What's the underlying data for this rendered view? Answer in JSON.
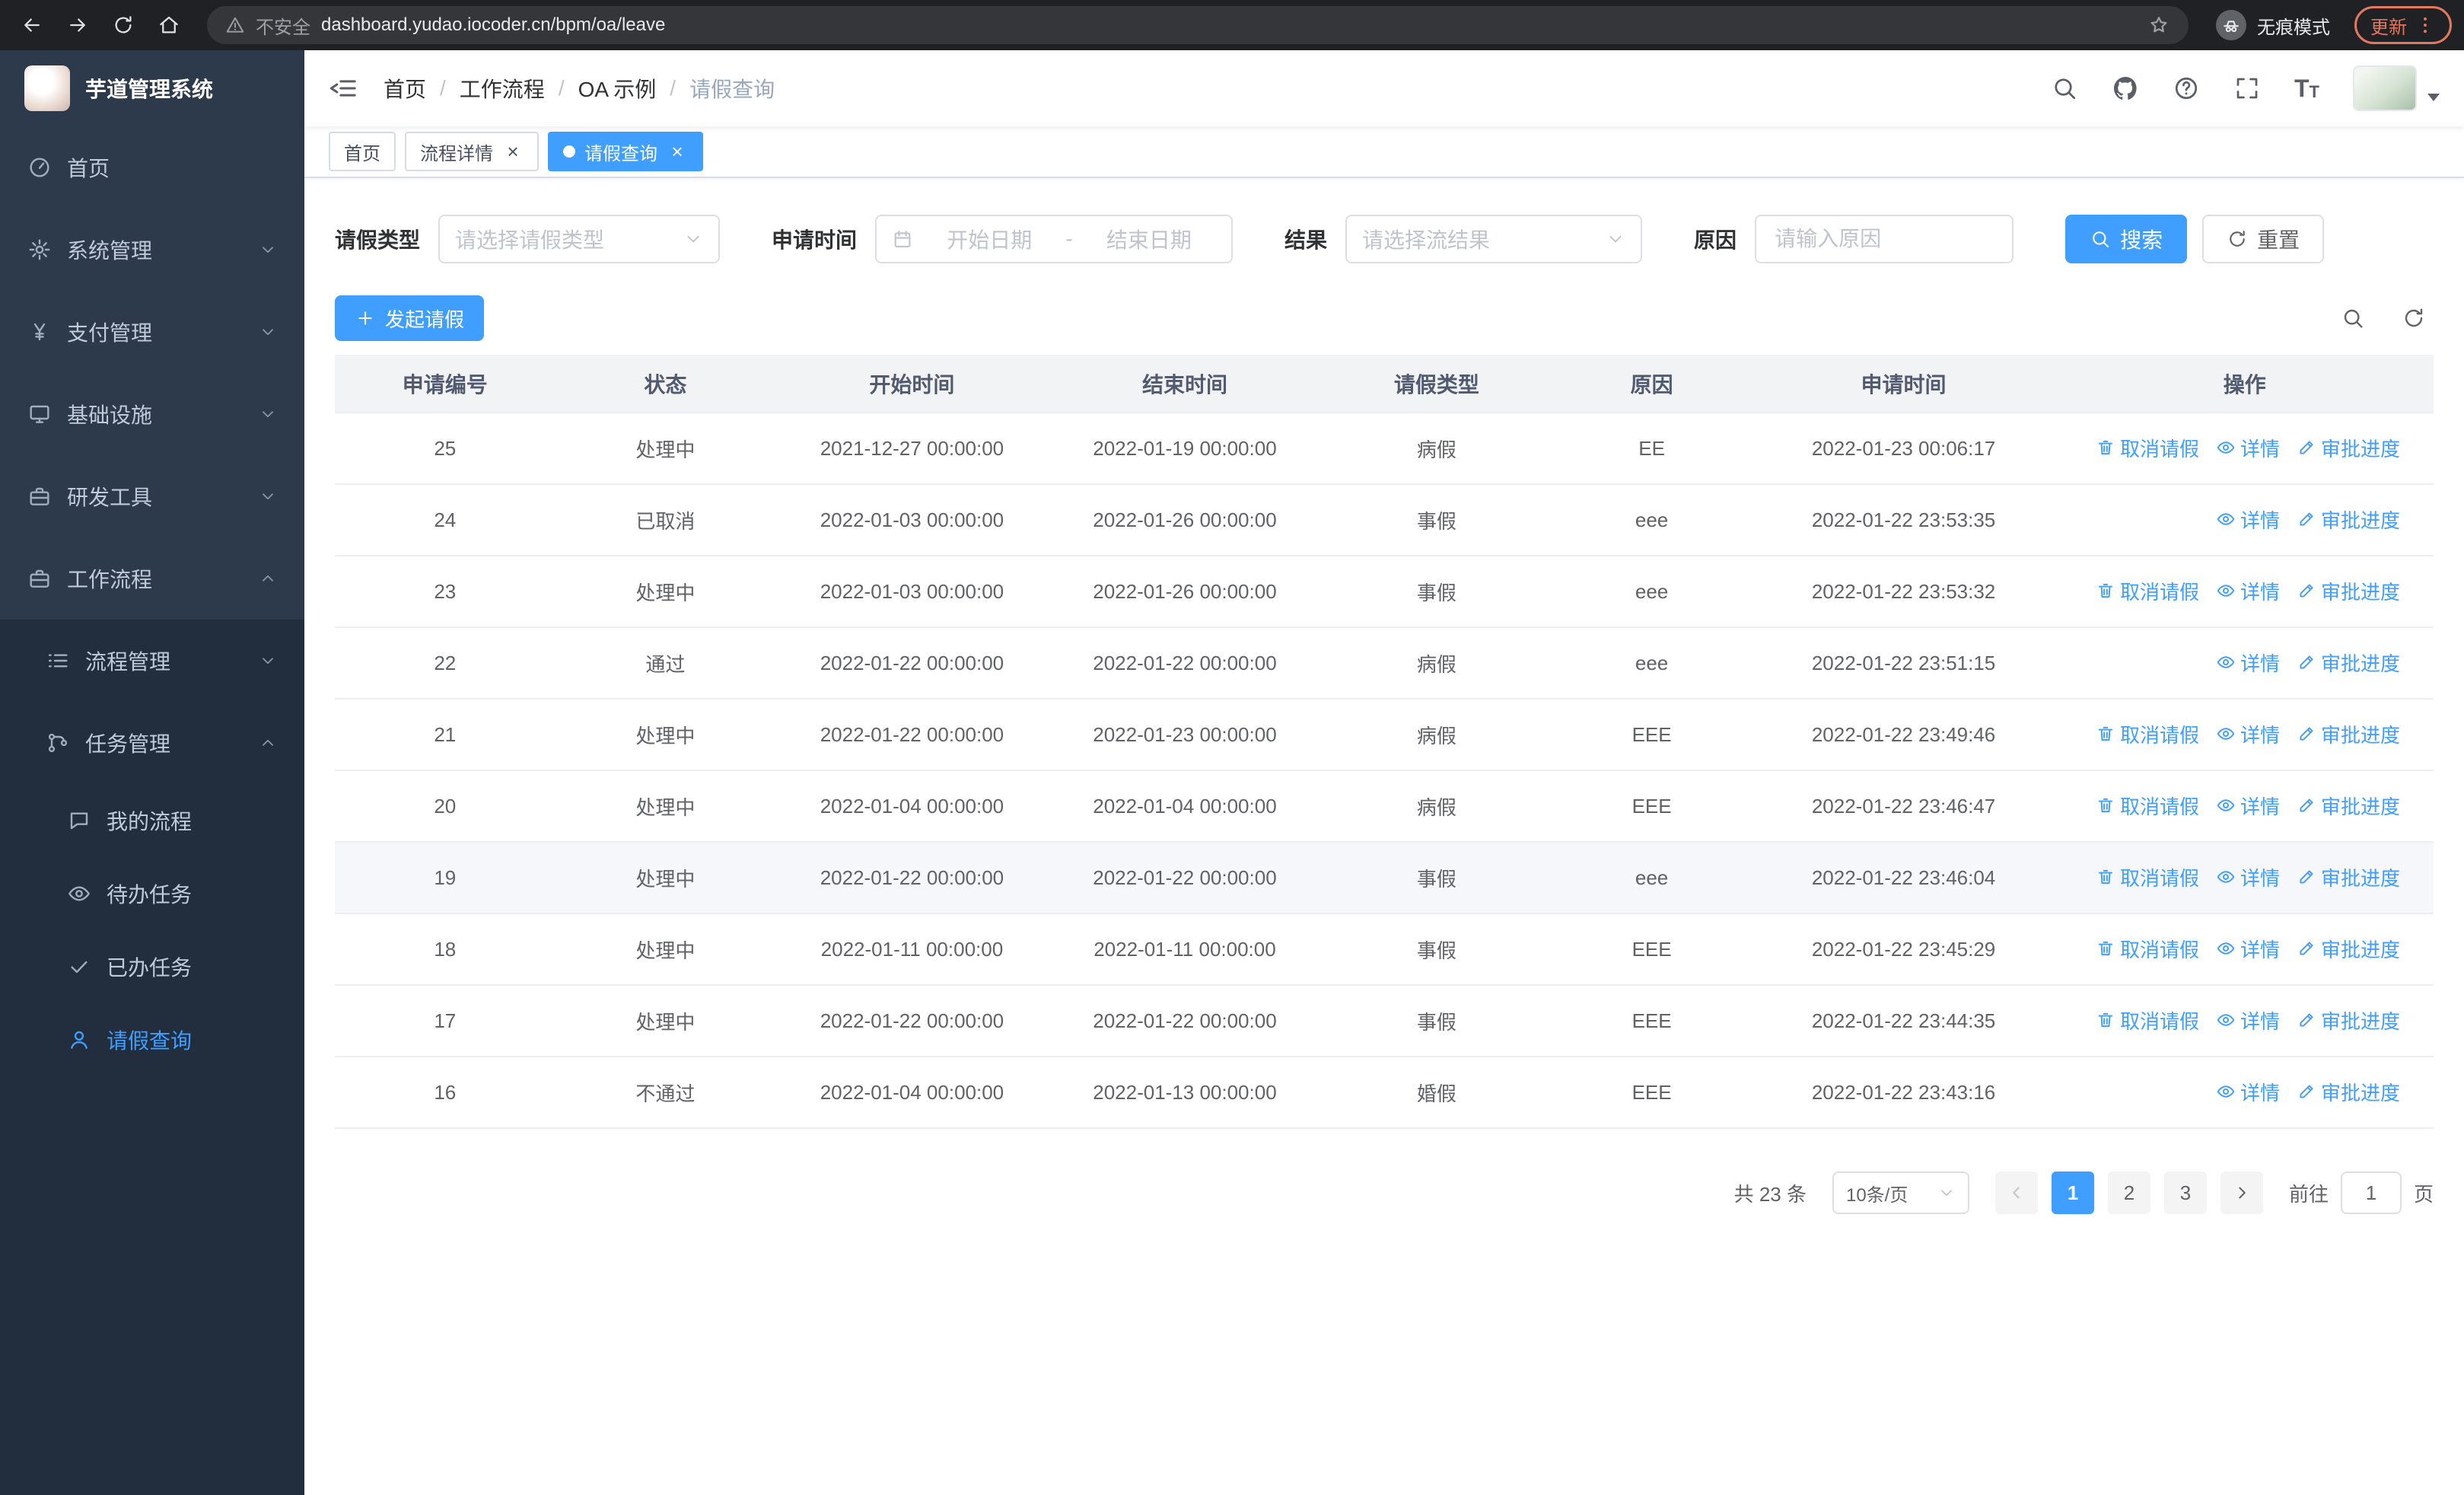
{
  "browser": {
    "security_label": "不安全",
    "url": "dashboard.yudao.iocoder.cn/bpm/oa/leave",
    "incognito_label": "无痕模式",
    "update_label": "更新"
  },
  "app": {
    "title": "芋道管理系统"
  },
  "colors": {
    "primary": "#409EFF",
    "sidebar_bg": "#2d3a4b",
    "sidebar_submenu_bg": "#222e3e",
    "active_tab_bg": "#409EFF"
  },
  "sidebar": {
    "items": [
      {
        "name": "home",
        "label": "首页",
        "icon": "gauge",
        "level": 1
      },
      {
        "name": "system",
        "label": "系统管理",
        "icon": "gear",
        "level": 1,
        "chevron": "down"
      },
      {
        "name": "payment",
        "label": "支付管理",
        "icon": "yen",
        "level": 1,
        "chevron": "down"
      },
      {
        "name": "infrastructure",
        "label": "基础设施",
        "icon": "monitor",
        "level": 1,
        "chevron": "down"
      },
      {
        "name": "dev-tools",
        "label": "研发工具",
        "icon": "toolbox",
        "level": 1,
        "chevron": "down"
      },
      {
        "name": "workflow",
        "label": "工作流程",
        "icon": "briefcase",
        "level": 1,
        "chevron": "up"
      },
      {
        "name": "process-management",
        "label": "流程管理",
        "icon": "list",
        "level": 2,
        "chevron": "down"
      },
      {
        "name": "task-management",
        "label": "任务管理",
        "icon": "flow",
        "level": 2,
        "chevron": "up"
      },
      {
        "name": "my-process",
        "label": "我的流程",
        "icon": "chat",
        "level": 3
      },
      {
        "name": "todo-tasks",
        "label": "待办任务",
        "icon": "eye",
        "level": 3
      },
      {
        "name": "done-tasks",
        "label": "已办任务",
        "icon": "check",
        "level": 3
      },
      {
        "name": "leave-query",
        "label": "请假查询",
        "icon": "user",
        "level": 3,
        "active": true
      }
    ]
  },
  "header": {
    "breadcrumb": [
      "首页",
      "工作流程",
      "OA 示例",
      "请假查询"
    ]
  },
  "tabs": [
    {
      "name": "home",
      "label": "首页",
      "closable": false,
      "active": false
    },
    {
      "name": "process-detail",
      "label": "流程详情",
      "closable": true,
      "active": false
    },
    {
      "name": "leave-query",
      "label": "请假查询",
      "closable": true,
      "active": true
    }
  ],
  "filters": {
    "leave_type": {
      "label": "请假类型",
      "placeholder": "请选择请假类型"
    },
    "apply_time": {
      "label": "申请时间",
      "start_placeholder": "开始日期",
      "separator": "-",
      "end_placeholder": "结束日期"
    },
    "result": {
      "label": "结果",
      "placeholder": "请选择流结果"
    },
    "reason": {
      "label": "原因",
      "placeholder": "请输入原因"
    },
    "search_label": "搜索",
    "reset_label": "重置"
  },
  "toolbar": {
    "create_label": "发起请假"
  },
  "table": {
    "columns": [
      "申请编号",
      "状态",
      "开始时间",
      "结束时间",
      "请假类型",
      "原因",
      "申请时间",
      "操作"
    ],
    "actions": {
      "cancel": "取消请假",
      "detail": "详情",
      "progress": "审批进度"
    },
    "rows": [
      {
        "id": "25",
        "status": "处理中",
        "start": "2021-12-27 00:00:00",
        "end": "2022-01-19 00:00:00",
        "type": "病假",
        "reason": "EE",
        "applied": "2022-01-23 00:06:17",
        "actions": [
          "cancel",
          "detail",
          "progress"
        ]
      },
      {
        "id": "24",
        "status": "已取消",
        "start": "2022-01-03 00:00:00",
        "end": "2022-01-26 00:00:00",
        "type": "事假",
        "reason": "eee",
        "applied": "2022-01-22 23:53:35",
        "actions": [
          "detail",
          "progress"
        ]
      },
      {
        "id": "23",
        "status": "处理中",
        "start": "2022-01-03 00:00:00",
        "end": "2022-01-26 00:00:00",
        "type": "事假",
        "reason": "eee",
        "applied": "2022-01-22 23:53:32",
        "actions": [
          "cancel",
          "detail",
          "progress"
        ]
      },
      {
        "id": "22",
        "status": "通过",
        "start": "2022-01-22 00:00:00",
        "end": "2022-01-22 00:00:00",
        "type": "病假",
        "reason": "eee",
        "applied": "2022-01-22 23:51:15",
        "actions": [
          "detail",
          "progress"
        ]
      },
      {
        "id": "21",
        "status": "处理中",
        "start": "2022-01-22 00:00:00",
        "end": "2022-01-23 00:00:00",
        "type": "病假",
        "reason": "EEE",
        "applied": "2022-01-22 23:49:46",
        "actions": [
          "cancel",
          "detail",
          "progress"
        ]
      },
      {
        "id": "20",
        "status": "处理中",
        "start": "2022-01-04 00:00:00",
        "end": "2022-01-04 00:00:00",
        "type": "病假",
        "reason": "EEE",
        "applied": "2022-01-22 23:46:47",
        "actions": [
          "cancel",
          "detail",
          "progress"
        ]
      },
      {
        "id": "19",
        "status": "处理中",
        "start": "2022-01-22 00:00:00",
        "end": "2022-01-22 00:00:00",
        "type": "事假",
        "reason": "eee",
        "applied": "2022-01-22 23:46:04",
        "actions": [
          "cancel",
          "detail",
          "progress"
        ],
        "highlight": true
      },
      {
        "id": "18",
        "status": "处理中",
        "start": "2022-01-11 00:00:00",
        "end": "2022-01-11 00:00:00",
        "type": "事假",
        "reason": "EEE",
        "applied": "2022-01-22 23:45:29",
        "actions": [
          "cancel",
          "detail",
          "progress"
        ]
      },
      {
        "id": "17",
        "status": "处理中",
        "start": "2022-01-22 00:00:00",
        "end": "2022-01-22 00:00:00",
        "type": "事假",
        "reason": "EEE",
        "applied": "2022-01-22 23:44:35",
        "actions": [
          "cancel",
          "detail",
          "progress"
        ]
      },
      {
        "id": "16",
        "status": "不通过",
        "start": "2022-01-04 00:00:00",
        "end": "2022-01-13 00:00:00",
        "type": "婚假",
        "reason": "EEE",
        "applied": "2022-01-22 23:43:16",
        "actions": [
          "detail",
          "progress"
        ]
      }
    ]
  },
  "pagination": {
    "total_text": "共 23 条",
    "page_size": "10条/页",
    "pages": [
      "1",
      "2",
      "3"
    ],
    "current": "1",
    "goto_label": "前往",
    "goto_value": "1",
    "page_label": "页"
  }
}
